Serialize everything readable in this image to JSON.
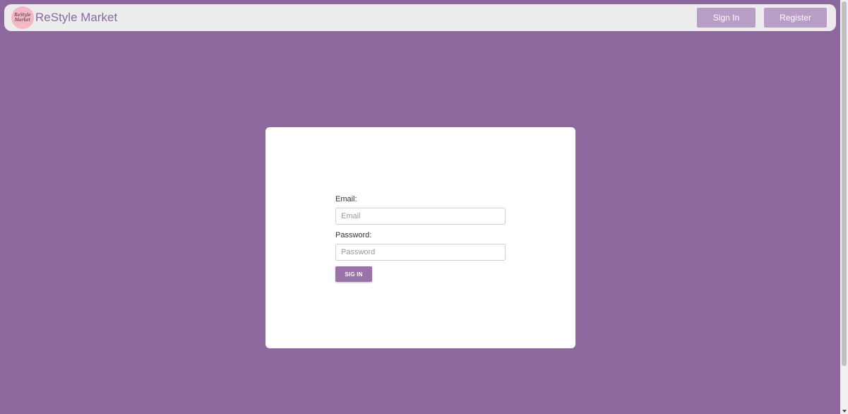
{
  "navbar": {
    "logo_line1": "ReStyle",
    "logo_line2": "Market",
    "brand": "ReStyle Market",
    "signin_label": "Sign In",
    "register_label": "Register"
  },
  "login_form": {
    "email_label": "Email:",
    "email_placeholder": "Email",
    "password_label": "Password:",
    "password_placeholder": "Password",
    "submit_label": "SIG IN"
  },
  "colors": {
    "background": "#8d689f",
    "navbar": "#ececec",
    "brand_text": "#8a6a9e",
    "nav_button": "#b89dc7",
    "submit_button": "#9a73ab"
  }
}
